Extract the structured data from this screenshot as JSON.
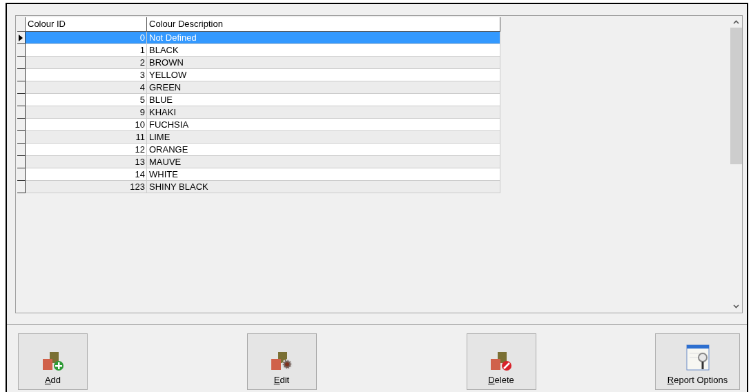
{
  "table": {
    "columns": [
      "Colour ID",
      "Colour Description"
    ],
    "rows": [
      {
        "id": "0",
        "description": "Not Defined",
        "selected": true
      },
      {
        "id": "1",
        "description": "BLACK",
        "selected": false
      },
      {
        "id": "2",
        "description": "BROWN",
        "selected": false
      },
      {
        "id": "3",
        "description": "YELLOW",
        "selected": false
      },
      {
        "id": "4",
        "description": "GREEN",
        "selected": false
      },
      {
        "id": "5",
        "description": "BLUE",
        "selected": false
      },
      {
        "id": "9",
        "description": "KHAKI",
        "selected": false
      },
      {
        "id": "10",
        "description": "FUCHSIA",
        "selected": false
      },
      {
        "id": "11",
        "description": "LIME",
        "selected": false
      },
      {
        "id": "12",
        "description": "ORANGE",
        "selected": false
      },
      {
        "id": "13",
        "description": "MAUVE",
        "selected": false
      },
      {
        "id": "14",
        "description": "WHITE",
        "selected": false
      },
      {
        "id": "123",
        "description": "SHINY BLACK",
        "selected": false
      }
    ]
  },
  "buttons": [
    {
      "label": "Add",
      "kind": "add"
    },
    {
      "label": "Edit",
      "kind": "edit"
    },
    {
      "label": "Delete",
      "kind": "delete"
    },
    {
      "label": "Report Options",
      "kind": "report"
    }
  ]
}
